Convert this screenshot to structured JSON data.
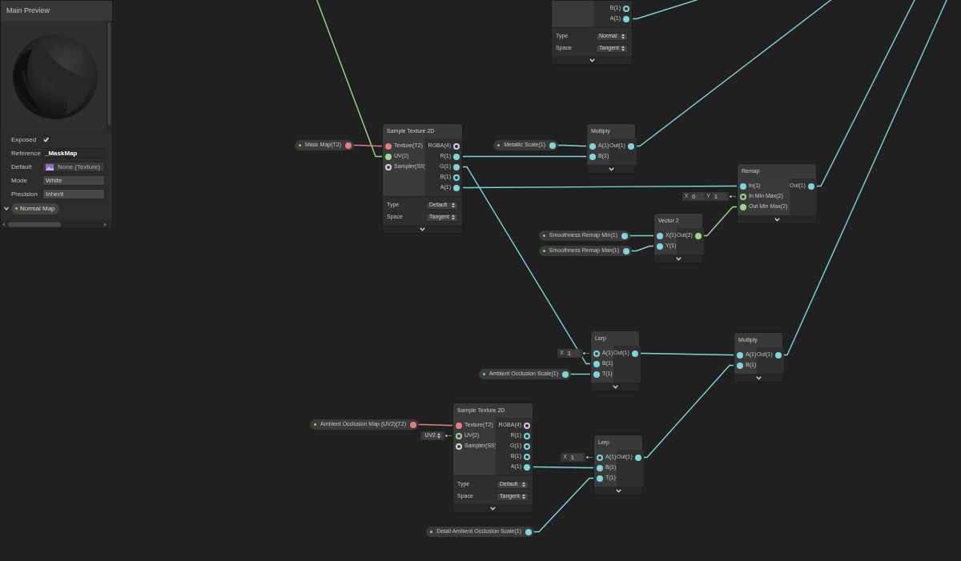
{
  "blackboard": {
    "title": "Main Preview",
    "fields": [
      {
        "label": "Exposed",
        "kind": "checkbox",
        "checked": true
      },
      {
        "label": "Reference",
        "kind": "text",
        "value": "_MaskMap"
      },
      {
        "label": "Default",
        "kind": "texture",
        "value": "None (Texture)"
      },
      {
        "label": "Mode",
        "kind": "dropdown",
        "value": "White"
      },
      {
        "label": "Precision",
        "kind": "dropdown",
        "value": "Inherit"
      }
    ],
    "property": {
      "label": "Normal Map",
      "expanded": true
    }
  },
  "property_nodes": [
    {
      "label": "Mask Map(T2)",
      "color": "#e07f7f"
    },
    {
      "label": "Metallic Scale(1)",
      "color": "#84d3d6"
    },
    {
      "label": "Smoothness Remap Min(1)",
      "color": "#84d3d6"
    },
    {
      "label": "Smoothness Remap Max(1)",
      "color": "#84d3d6"
    },
    {
      "label": "Ambient Occlusion Scale(1)",
      "color": "#84d3d6"
    },
    {
      "label": "Ambient Occlusion Map (UV2)(T2)",
      "color": "#e07f7f"
    },
    {
      "label": "Detail Ambient Occlusion Scale(1)",
      "color": "#84d3d6"
    }
  ],
  "nodes": [
    {
      "outputs": [
        {
          "label": "B(1)",
          "color": "#84d3d6",
          "connected": false
        },
        {
          "label": "A(1)",
          "color": "#84d3d6",
          "connected": true
        }
      ],
      "settings": [
        {
          "label": "Type",
          "value": "Normal"
        },
        {
          "label": "Space",
          "value": "Tangent"
        }
      ]
    },
    {
      "title": "Sample Texture 2D",
      "inputs": [
        {
          "label": "Texture(T2)",
          "color": "#e07f7f",
          "connected": true
        },
        {
          "label": "UV(2)",
          "color": "#9fd68f",
          "connected": true
        },
        {
          "label": "Sampler(SS)",
          "color": "#d4d4d4",
          "connected": false
        }
      ],
      "outputs": [
        {
          "label": "RGBA(4)",
          "color": "#dcc4e4",
          "connected": false
        },
        {
          "label": "R(1)",
          "color": "#84d3d6",
          "connected": true
        },
        {
          "label": "G(1)",
          "color": "#84d3d6",
          "connected": true
        },
        {
          "label": "B(1)",
          "color": "#84d3d6",
          "connected": false
        },
        {
          "label": "A(1)",
          "color": "#84d3d6",
          "connected": true
        }
      ],
      "settings": [
        {
          "label": "Type",
          "value": "Default"
        },
        {
          "label": "Space",
          "value": "Tangent"
        }
      ]
    },
    {
      "title": "Multiply",
      "inputs": [
        {
          "label": "A(1)",
          "color": "#84d3d6",
          "connected": true
        },
        {
          "label": "B(1)",
          "color": "#84d3d6",
          "connected": true
        }
      ],
      "outputs": [
        {
          "label": "Out(1)",
          "color": "#84d3d6",
          "connected": true
        }
      ]
    },
    {
      "title": "Remap",
      "inputs": [
        {
          "label": "In(1)",
          "color": "#84d3d6",
          "connected": true
        },
        {
          "label": "In Min Max(2)",
          "color": "#9fd68f",
          "connected": false,
          "default": {
            "kind": "vector",
            "fields": [
              {
                "axis": "X",
                "value": "0"
              },
              {
                "axis": "Y",
                "value": "1"
              }
            ]
          }
        },
        {
          "label": "Out Min Max(2)",
          "color": "#9fd68f",
          "connected": true
        }
      ],
      "outputs": [
        {
          "label": "Out(1)",
          "color": "#84d3d6",
          "connected": true
        }
      ]
    },
    {
      "title": "Vector 2",
      "inputs": [
        {
          "label": "X(1)",
          "color": "#84d3d6",
          "connected": true
        },
        {
          "label": "Y(1)",
          "color": "#84d3d6",
          "connected": true
        }
      ],
      "outputs": [
        {
          "label": "Out(2)",
          "color": "#9fd68f",
          "connected": true
        }
      ]
    },
    {
      "title": "Lerp",
      "inputs": [
        {
          "label": "A(1)",
          "color": "#84d3d6",
          "connected": false,
          "default": {
            "kind": "vector",
            "fields": [
              {
                "axis": "X",
                "value": "1"
              }
            ]
          }
        },
        {
          "label": "B(1)",
          "color": "#84d3d6",
          "connected": true
        },
        {
          "label": "T(1)",
          "color": "#84d3d6",
          "connected": true
        }
      ],
      "outputs": [
        {
          "label": "Out(1)",
          "color": "#84d3d6",
          "connected": true
        }
      ]
    },
    {
      "title": "Multiply",
      "inputs": [
        {
          "label": "A(1)",
          "color": "#84d3d6",
          "connected": true
        },
        {
          "label": "B(1)",
          "color": "#84d3d6",
          "connected": true
        }
      ],
      "outputs": [
        {
          "label": "Out(1)",
          "color": "#84d3d6",
          "connected": true
        }
      ]
    },
    {
      "title": "Sample Texture 2D",
      "inputs": [
        {
          "label": "Texture(T2)",
          "color": "#e07f7f",
          "connected": true
        },
        {
          "label": "UV(2)",
          "color": "#9fd68f",
          "connected": false,
          "default": {
            "kind": "dropdown",
            "value": "UV2"
          }
        },
        {
          "label": "Sampler(SS)",
          "color": "#d4d4d4",
          "connected": false
        }
      ],
      "outputs": [
        {
          "label": "RGBA(4)",
          "color": "#dcc4e4",
          "connected": false
        },
        {
          "label": "R(1)",
          "color": "#84d3d6",
          "connected": false
        },
        {
          "label": "G(1)",
          "color": "#84d3d6",
          "connected": false
        },
        {
          "label": "B(1)",
          "color": "#84d3d6",
          "connected": false
        },
        {
          "label": "A(1)",
          "color": "#84d3d6",
          "connected": true
        }
      ],
      "settings": [
        {
          "label": "Type",
          "value": "Default"
        },
        {
          "label": "Space",
          "value": "Tangent"
        }
      ]
    },
    {
      "title": "Lerp",
      "inputs": [
        {
          "label": "A(1)",
          "color": "#84d3d6",
          "connected": false,
          "default": {
            "kind": "vector",
            "fields": [
              {
                "axis": "X",
                "value": "1"
              }
            ]
          }
        },
        {
          "label": "B(1)",
          "color": "#84d3d6",
          "connected": true
        },
        {
          "label": "T(1)",
          "color": "#84d3d6",
          "connected": true
        }
      ],
      "outputs": [
        {
          "label": "Out(1)",
          "color": "#84d3d6",
          "connected": true
        }
      ]
    }
  ]
}
